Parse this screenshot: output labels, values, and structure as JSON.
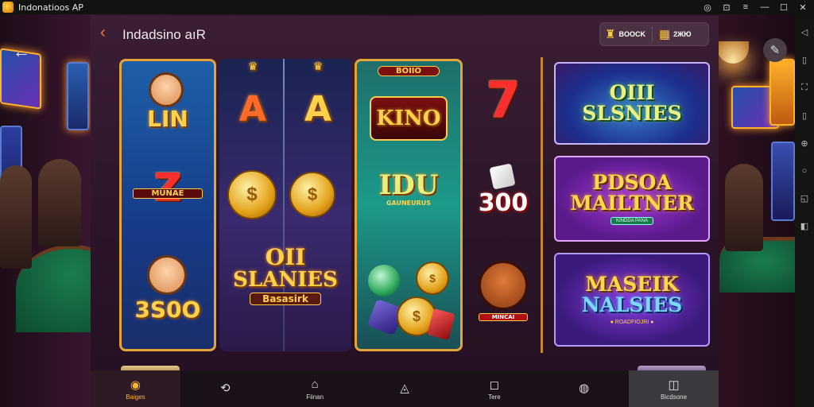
{
  "window": {
    "title": "Indonatioos AP",
    "controls": [
      "◎",
      "⊡",
      "≡",
      "—",
      "☐",
      "✕"
    ]
  },
  "right_toolbar": {
    "icons": [
      "◁",
      "▯",
      "⛶",
      "▯",
      "⊕",
      "○",
      "◱",
      "◧"
    ]
  },
  "header": {
    "back_glyph": "‹",
    "title": "Indadsino aıR",
    "wallet": {
      "coin1_amount": "BOOCK",
      "coin2_amount": "2ЖЮ"
    }
  },
  "reels": {
    "reel1": {
      "top_symbol": "LIN",
      "mid_symbol": "Z",
      "mid_banner": "MUNAE",
      "bottom_symbol": "3S0O"
    },
    "reel2": {
      "top_symbols": [
        "A",
        "A"
      ],
      "coin_symbol": "$",
      "logo_line1": "OII",
      "logo_line2": "SLANIES",
      "logo_line3": "Basasirk"
    },
    "reel3": {
      "top_label": "BOIIO",
      "top_symbol": "KINO",
      "mid_symbol": "IDU",
      "mid_sub": "GAUNEURUS"
    },
    "extra_col": {
      "top_symbol": "7",
      "mid_symbol": "300",
      "bottom_tag": "MINCAI"
    }
  },
  "promos": [
    {
      "line1": "OIII",
      "line2": "SLSNIES",
      "tag": ""
    },
    {
      "line1": "PDSOA",
      "line2": "MAILTNER",
      "tag": "KINDDA PANA"
    },
    {
      "line1": "MASEIK",
      "line2": "NALSIES",
      "tag": "● ROADFIOJRI ●"
    }
  ],
  "nav": {
    "items": [
      {
        "icon": "◉",
        "label": "Baiges"
      },
      {
        "icon": "⟲",
        "label": ""
      },
      {
        "icon": "⌂",
        "label": "Fiinan"
      },
      {
        "icon": "◬",
        "label": ""
      },
      {
        "icon": "◻",
        "label": "Tere"
      },
      {
        "icon": "◍",
        "label": ""
      },
      {
        "icon": "◫",
        "label": "Bicdsone"
      }
    ]
  },
  "colors": {
    "accent": "#ffb52a",
    "panel": "#2b1428",
    "gold_border": "#e5a43a"
  }
}
